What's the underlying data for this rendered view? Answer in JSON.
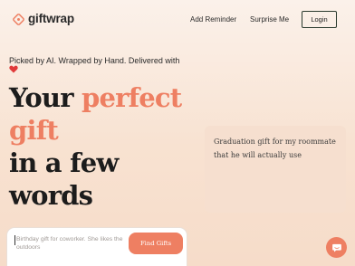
{
  "brand": {
    "name": "giftwrap",
    "logo_icon": "gift-logo-icon",
    "accent_color": "#ee7f62"
  },
  "nav": {
    "links": [
      {
        "label": "Add Reminder"
      },
      {
        "label": "Surprise Me"
      }
    ],
    "login_label": "Login"
  },
  "hero": {
    "tagline": "Picked by AI. Wrapped by Hand. Delivered with",
    "tagline_icon": "heart-icon",
    "headline": {
      "line1_plain": "Your ",
      "line1_accent": "perfect",
      "line2_accent": "gift",
      "line3": "in a few",
      "line4": "words"
    }
  },
  "search": {
    "placeholder": "Birthday gift for coworker. She likes the outdoors",
    "button_label": "Find Gifts"
  },
  "example": {
    "text": "Graduation gift for my roommate that he will actually use"
  },
  "chat": {
    "icon": "chat-icon"
  }
}
